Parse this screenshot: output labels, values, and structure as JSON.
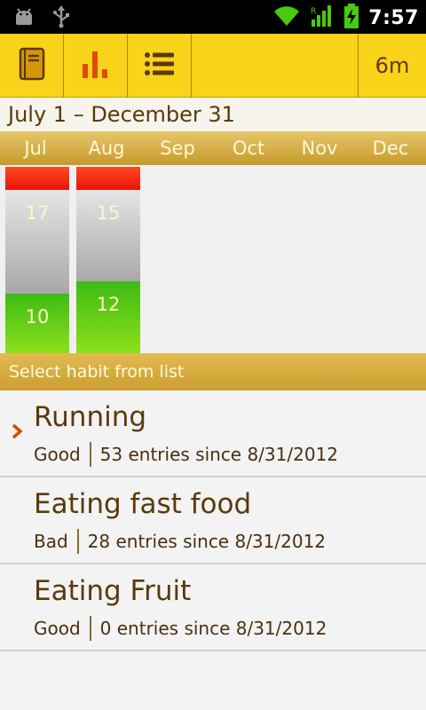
{
  "status_bar": {
    "time": "7:57",
    "icons": [
      "android-debug-icon",
      "usb-icon",
      "wifi-icon",
      "signal-icon",
      "battery-charging-icon"
    ]
  },
  "toolbar": {
    "buttons": [
      {
        "name": "journal-book-icon",
        "color": "#d6960a"
      },
      {
        "name": "bar-chart-icon",
        "color": "#e04a0e"
      },
      {
        "name": "list-icon",
        "color": "#5a3a0a"
      }
    ],
    "timer": "6m"
  },
  "date_range": "July 1 – December 31",
  "months": [
    "Jul",
    "Aug",
    "Sep",
    "Oct",
    "Nov",
    "Dec"
  ],
  "chart_data": {
    "type": "bar",
    "stacked": true,
    "categories": [
      "Jul",
      "Aug"
    ],
    "series": [
      {
        "color": "#e8140a",
        "values": [
          2,
          2
        ]
      },
      {
        "color": "#a8a8a8",
        "values": [
          17,
          15
        ]
      },
      {
        "color": "#6fcf17",
        "values": [
          10,
          12
        ]
      }
    ],
    "labels": {
      "gray": [
        "17",
        "15"
      ],
      "green": [
        "10",
        "12"
      ]
    }
  },
  "section_header": "Select habit from list",
  "habits": [
    {
      "name": "Running",
      "type": "Good",
      "entries": "53 entries since 8/31/2012",
      "selected": true
    },
    {
      "name": "Eating fast food",
      "type": "Bad",
      "entries": "28 entries since 8/31/2012",
      "selected": false
    },
    {
      "name": "Eating Fruit",
      "type": "Good",
      "entries": "0 entries since 8/31/2012",
      "selected": false
    }
  ]
}
